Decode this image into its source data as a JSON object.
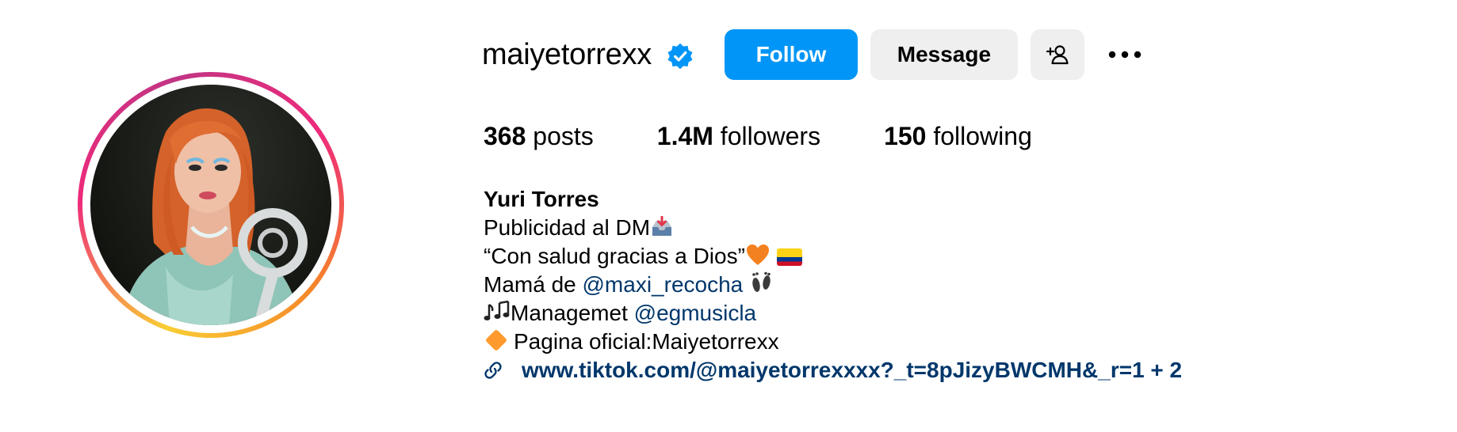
{
  "profile": {
    "username": "maiyetorrexx",
    "verified": true,
    "follow_label": "Follow",
    "message_label": "Message"
  },
  "stats": {
    "posts_count": "368",
    "posts_label": "posts",
    "followers_count": "1.4M",
    "followers_label": "followers",
    "following_count": "150",
    "following_label": "following"
  },
  "bio": {
    "name": "Yuri Torres",
    "line1": "Publicidad al DM",
    "line2": "“Con salud gracias a Dios”",
    "line3_prefix": "Mamá de ",
    "line3_mention": "@maxi_recocha",
    "line4_prefix": "Managemet ",
    "line4_mention": "@egmusicla",
    "line5": "Pagina oficial:Maiyetorrexx",
    "link": "www.tiktok.com/@maiyetorrexxxx?_t=8pJizyBWCMH&_r=1 + 2"
  },
  "icons": {
    "verified": "verified-badge-icon",
    "add_user": "add-person-icon",
    "more": "more-options-icon",
    "link": "link-icon",
    "inbox": "inbox-tray-icon",
    "heart": "orange-heart-icon",
    "flag": "colombia-flag-icon",
    "feet": "footprints-icon",
    "notes": "musical-notes-icon",
    "diamond": "orange-diamond-icon"
  },
  "colors": {
    "follow_button": "#0095f6",
    "secondary_button": "#efefef",
    "mention": "#00376b",
    "verified": "#0095f6"
  }
}
